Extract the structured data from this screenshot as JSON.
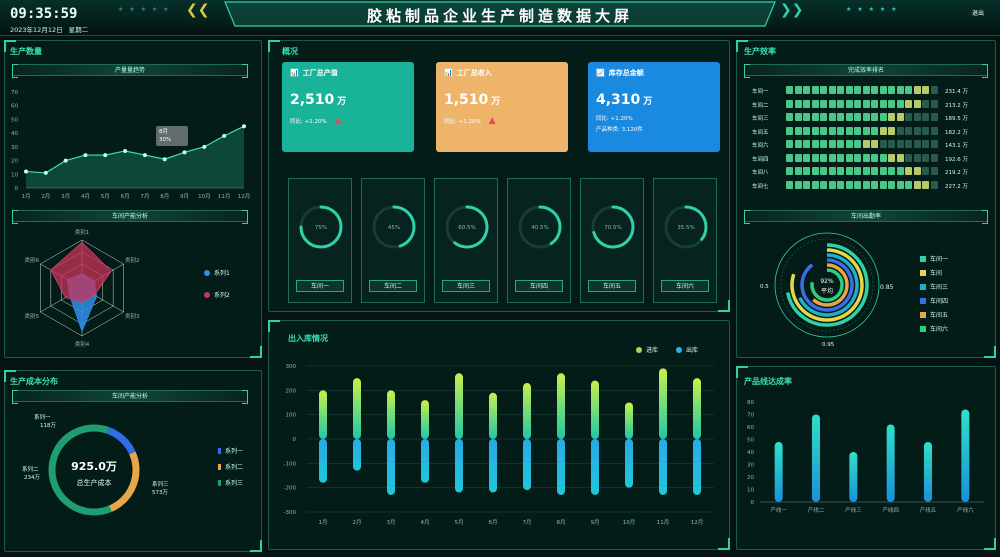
{
  "header": {
    "time": "09:35:59",
    "date": "2023年12月12日",
    "weekday": "星期二",
    "title": "胶粘制品企业生产制造数据大屏",
    "exit": "退出"
  },
  "production": {
    "title": "生产数量",
    "subtitle": "产量量趋势",
    "tooltip_month": "8月",
    "tooltip_value": "30%"
  },
  "radar": {
    "subtitle": "车间产能分析",
    "series_labels": [
      "系列1",
      "系列2"
    ]
  },
  "cost": {
    "title": "生产成本分布",
    "subtitle": "车间产能分析",
    "center_value": "925.0万",
    "center_label": "总生产成本",
    "segments": [
      {
        "name": "系列一",
        "value": "118万"
      },
      {
        "name": "系列二",
        "value": "234万"
      },
      {
        "name": "系列三",
        "value": "573万"
      }
    ]
  },
  "overview": {
    "title": "概况",
    "cards": [
      {
        "title": "工厂总产值",
        "value": "2,510",
        "unit": "万",
        "sub": "同比: +1.20%",
        "sub2": ""
      },
      {
        "title": "工厂总收入",
        "value": "1,510",
        "unit": "万",
        "sub": "同比: +1.20%",
        "sub2": ""
      },
      {
        "title": "库存总金额",
        "value": "4,310",
        "unit": "万",
        "sub": "同比: +1.20%",
        "sub2": "产品种类: 3,120件"
      }
    ],
    "gauges": [
      {
        "label": "车间一",
        "percent": "75%",
        "value": 0.75
      },
      {
        "label": "车间二",
        "percent": "45%",
        "value": 0.45
      },
      {
        "label": "车间三",
        "percent": "60.5%",
        "value": 0.605
      },
      {
        "label": "车间四",
        "percent": "40.5%",
        "value": 0.405
      },
      {
        "label": "车间五",
        "percent": "70.5%",
        "value": 0.705
      },
      {
        "label": "车间六",
        "percent": "35.5%",
        "value": 0.355
      }
    ]
  },
  "inout": {
    "title": "出入库情况",
    "legend": [
      "进库",
      "出库"
    ]
  },
  "efficiency": {
    "title": "生产效率",
    "subtitle": "完成效率排名",
    "rows": [
      {
        "name": "车间一",
        "value": "231.4 万",
        "filled": 15,
        "total": 18
      },
      {
        "name": "车间二",
        "value": "213.2 万",
        "filled": 14,
        "total": 18
      },
      {
        "name": "车间三",
        "value": "189.5 万",
        "filled": 12,
        "total": 18
      },
      {
        "name": "车间五",
        "value": "182.2 万",
        "filled": 11,
        "total": 18
      },
      {
        "name": "车间六",
        "value": "143.1 万",
        "filled": 9,
        "total": 18
      },
      {
        "name": "车间四",
        "value": "192.6 万",
        "filled": 12,
        "total": 18
      },
      {
        "name": "车间八",
        "value": "219.2 万",
        "filled": 14,
        "total": 18
      },
      {
        "name": "车间七",
        "value": "227.2 万",
        "filled": 15,
        "total": 18
      }
    ],
    "rate_subtitle": "车间出勤率",
    "rate_center_value": "92%",
    "rate_center_label": "平均",
    "rate_label_left": "0.5",
    "rate_label_right": "0.85",
    "rate_label_bottom": "0.95",
    "rate_legend": [
      {
        "name": "车间一",
        "color": "#2fd1a7"
      },
      {
        "name": "车间",
        "color": "#e8d64a"
      },
      {
        "name": "车间三",
        "color": "#1fb0c8"
      },
      {
        "name": "车间四",
        "color": "#3c6de8"
      },
      {
        "name": "车间五",
        "color": "#e8a64a"
      },
      {
        "name": "车间六",
        "color": "#2ecf7a"
      }
    ]
  },
  "yield": {
    "title": "产品线达成率"
  },
  "chart_data": [
    {
      "type": "line",
      "categories": [
        "1月",
        "2月",
        "3月",
        "4月",
        "5月",
        "6月",
        "7月",
        "8月",
        "9月",
        "10月",
        "11月",
        "12月"
      ],
      "values": [
        12,
        11,
        20,
        24,
        24,
        27,
        24,
        21,
        26,
        30,
        38,
        45
      ],
      "ylim": [
        0,
        70
      ],
      "yticks": [
        0,
        10,
        20,
        30,
        40,
        50,
        60,
        70
      ]
    },
    {
      "type": "radar",
      "axes": [
        "类别1",
        "类别2",
        "类别3",
        "类别4",
        "类别5",
        "类别6"
      ],
      "series": [
        {
          "name": "系列1",
          "values": [
            0.3,
            0.3,
            0.35,
            0.9,
            0.3,
            0.35
          ]
        },
        {
          "name": "系列2",
          "values": [
            0.95,
            0.7,
            0.3,
            0.3,
            0.4,
            0.75
          ]
        }
      ]
    },
    {
      "type": "pie",
      "categories": [
        "系列一",
        "系列二",
        "系列三"
      ],
      "values": [
        118,
        234,
        573
      ]
    },
    {
      "type": "bar",
      "categories": [
        "1月",
        "2月",
        "3月",
        "4月",
        "5月",
        "6月",
        "7月",
        "8月",
        "9月",
        "10月",
        "11月",
        "12月"
      ],
      "series": [
        {
          "name": "进库",
          "values": [
            200,
            250,
            200,
            160,
            270,
            190,
            230,
            270,
            240,
            150,
            290,
            250
          ]
        },
        {
          "name": "出库",
          "values": [
            -180,
            -130,
            -230,
            -180,
            -220,
            -220,
            -210,
            -230,
            -230,
            -200,
            -230,
            -230
          ]
        }
      ],
      "ylim": [
        -300,
        300
      ],
      "yticks": [
        300,
        200,
        100,
        0,
        -100,
        -200,
        -300
      ]
    },
    {
      "type": "bar",
      "categories": [
        "产线一",
        "产线二",
        "产线三",
        "产线四",
        "产线五",
        "产线六"
      ],
      "values": [
        48,
        70,
        40,
        62,
        48,
        74
      ],
      "ylim": [
        0,
        80
      ],
      "yticks": [
        0,
        10,
        20,
        30,
        40,
        50,
        60,
        70,
        80
      ]
    }
  ]
}
